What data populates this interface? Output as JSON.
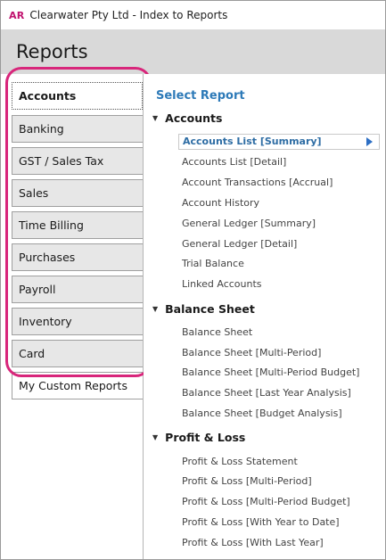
{
  "window": {
    "logo": "AR",
    "title": "Clearwater Pty Ltd - Index to Reports"
  },
  "header": {
    "title": "Reports"
  },
  "sidebar": {
    "tabs": [
      {
        "label": "Accounts",
        "active": true
      },
      {
        "label": "Banking"
      },
      {
        "label": "GST / Sales Tax"
      },
      {
        "label": "Sales"
      },
      {
        "label": "Time Billing"
      },
      {
        "label": "Purchases"
      },
      {
        "label": "Payroll"
      },
      {
        "label": "Inventory"
      },
      {
        "label": "Card"
      },
      {
        "label": "My Custom Reports"
      }
    ]
  },
  "report_pane": {
    "heading": "Select Report",
    "groups": [
      {
        "name": "Accounts",
        "items": [
          "Accounts List [Summary]",
          "Accounts List [Detail]",
          "Account Transactions [Accrual]",
          "Account History",
          "General Ledger [Summary]",
          "General Ledger [Detail]",
          "Trial Balance",
          "Linked Accounts"
        ]
      },
      {
        "name": "Balance Sheet",
        "items": [
          "Balance Sheet",
          "Balance Sheet [Multi-Period]",
          "Balance Sheet [Multi-Period Budget]",
          "Balance Sheet [Last Year Analysis]",
          "Balance Sheet [Budget Analysis]"
        ]
      },
      {
        "name": "Profit & Loss",
        "items": [
          "Profit & Loss Statement",
          "Profit & Loss [Multi-Period]",
          "Profit & Loss [Multi-Period Budget]",
          "Profit & Loss [With Year to Date]",
          "Profit & Loss [With Last Year]"
        ]
      }
    ]
  },
  "colors": {
    "accent": "#2d7ab8",
    "highlight_ring": "#d8267b",
    "logo": "#c0126e"
  }
}
